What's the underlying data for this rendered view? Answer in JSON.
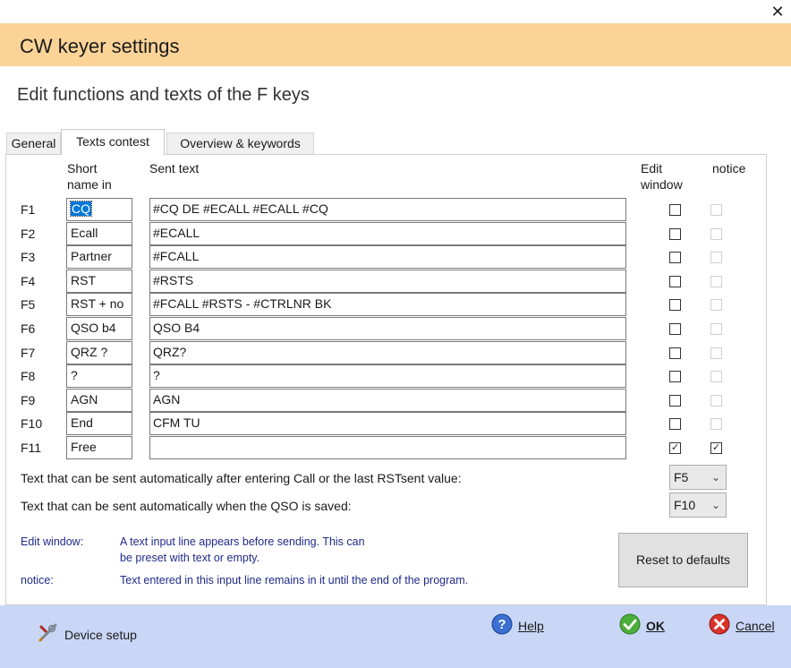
{
  "window": {
    "close_glyph": "✕"
  },
  "header": {
    "title": "CW keyer settings",
    "subtitle": "Edit functions and texts of the F keys"
  },
  "tabs": [
    {
      "label": "General",
      "active": false
    },
    {
      "label": "Texts contest",
      "active": true
    },
    {
      "label": "Overview & keywords",
      "active": false
    }
  ],
  "columns": {
    "short_line1": "Short",
    "short_line2": "name in",
    "sent": "Sent text",
    "edit_line1": "Edit",
    "edit_line2": "window",
    "notice": "notice"
  },
  "rows": [
    {
      "key": "F1",
      "short": "CQ",
      "sent": "#CQ DE #ECALL #ECALL #CQ",
      "edit": false,
      "notice": false,
      "notice_enabled": false
    },
    {
      "key": "F2",
      "short": "Ecall",
      "sent": "#ECALL",
      "edit": false,
      "notice": false,
      "notice_enabled": false
    },
    {
      "key": "F3",
      "short": "Partner",
      "sent": "#FCALL",
      "edit": false,
      "notice": false,
      "notice_enabled": false
    },
    {
      "key": "F4",
      "short": "RST",
      "sent": "#RSTS",
      "edit": false,
      "notice": false,
      "notice_enabled": false
    },
    {
      "key": "F5",
      "short": "RST + no",
      "sent": "#FCALL #RSTS - #CTRLNR BK",
      "edit": false,
      "notice": false,
      "notice_enabled": false
    },
    {
      "key": "F6",
      "short": "QSO b4",
      "sent": "QSO B4",
      "edit": false,
      "notice": false,
      "notice_enabled": false
    },
    {
      "key": "F7",
      "short": "QRZ ?",
      "sent": "QRZ?",
      "edit": false,
      "notice": false,
      "notice_enabled": false
    },
    {
      "key": "F8",
      "short": "?",
      "sent": "?",
      "edit": false,
      "notice": false,
      "notice_enabled": false
    },
    {
      "key": "F9",
      "short": "AGN",
      "sent": "AGN",
      "edit": false,
      "notice": false,
      "notice_enabled": false
    },
    {
      "key": "F10",
      "short": "End",
      "sent": "CFM TU",
      "edit": false,
      "notice": false,
      "notice_enabled": false
    },
    {
      "key": "F11",
      "short": "Free",
      "sent": "",
      "edit": true,
      "notice": true,
      "notice_enabled": true
    }
  ],
  "auto_send": {
    "after_call_label": "Text that can be sent automatically after entering Call or the last RSTsent value:",
    "after_call_value": "F5",
    "on_save_label": "Text that can be sent automatically when the QSO is saved:",
    "on_save_value": "F10"
  },
  "notes": {
    "edit_window_term": "Edit window:",
    "edit_window_line1": "A text input line appears before sending. This can",
    "edit_window_line2": "be preset with text or empty.",
    "notice_term": "notice:",
    "notice_text": "Text entered in this input line remains in it until the end of the program."
  },
  "buttons": {
    "reset": "Reset to defaults",
    "device_setup": "Device setup",
    "help": "Help",
    "ok": "OK",
    "cancel": "Cancel"
  },
  "colors": {
    "title_bar": "#fbd397",
    "footer": "#c9d6f6",
    "note_text": "#1f2a8a",
    "selection": "#0078d7"
  }
}
